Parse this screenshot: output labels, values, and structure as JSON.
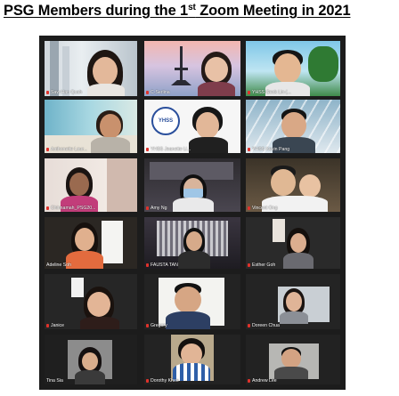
{
  "title": {
    "before_sup": "PSG Members during the 1",
    "sup": "st",
    "after_sup": " Zoom Meeting in 2021"
  },
  "participants": [
    {
      "name": "Saw Han Quah"
    },
    {
      "name": "C-Serlina"
    },
    {
      "name": "YHSS Geok Lin (..."
    },
    {
      "name": "Anthonette Lour..."
    },
    {
      "name": "YHSS Jeanette Li..."
    },
    {
      "name": "YHSS Kevin Pang"
    },
    {
      "name": "Chinnamah_PSG20..."
    },
    {
      "name": "Amy Ng"
    },
    {
      "name": "Vincent Ong"
    },
    {
      "name": "Adeline Soh"
    },
    {
      "name": "FAUSTA TAN"
    },
    {
      "name": "Esther Goh"
    },
    {
      "name": "Janice"
    },
    {
      "name": "Gregory"
    },
    {
      "name": "Doreen Chua"
    },
    {
      "name": "Tina Sia"
    },
    {
      "name": "Dorothy Khee"
    },
    {
      "name": "Andrew Lee"
    }
  ],
  "school_logo_text": "YHSS",
  "colors": {
    "grid_background": "#1c1c1c",
    "muted_mic": "#e0322b",
    "label_text": "#ffffff"
  }
}
